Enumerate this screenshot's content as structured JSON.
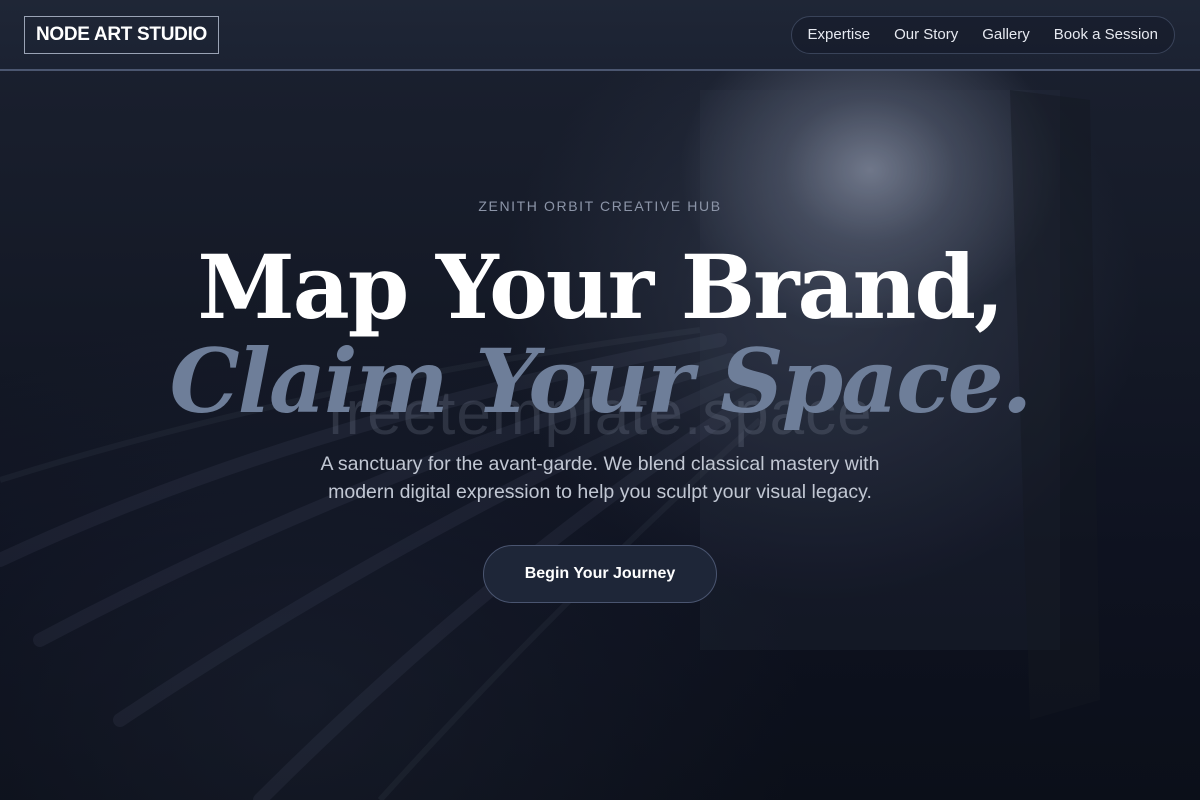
{
  "brand": {
    "logo_text": "NODE ART STUDIO"
  },
  "nav": {
    "items": [
      {
        "label": "Expertise"
      },
      {
        "label": "Our Story"
      },
      {
        "label": "Gallery"
      },
      {
        "label": "Book a Session"
      }
    ]
  },
  "hero": {
    "eyebrow": "ZENITH ORBIT CREATIVE HUB",
    "headline_line1": "Map Your Brand,",
    "headline_line2": "Claim Your Space.",
    "watermark": "freetemplate.space",
    "description_line1": "A sanctuary for the avant-garde. We blend classical mastery with",
    "description_line2": "modern digital expression to help you sculpt your visual legacy.",
    "cta_label": "Begin Your Journey"
  },
  "colors": {
    "background": "#0d111c",
    "header": "#1f2636",
    "accent_muted": "#6e7e99",
    "button_bg": "#1e2638"
  }
}
